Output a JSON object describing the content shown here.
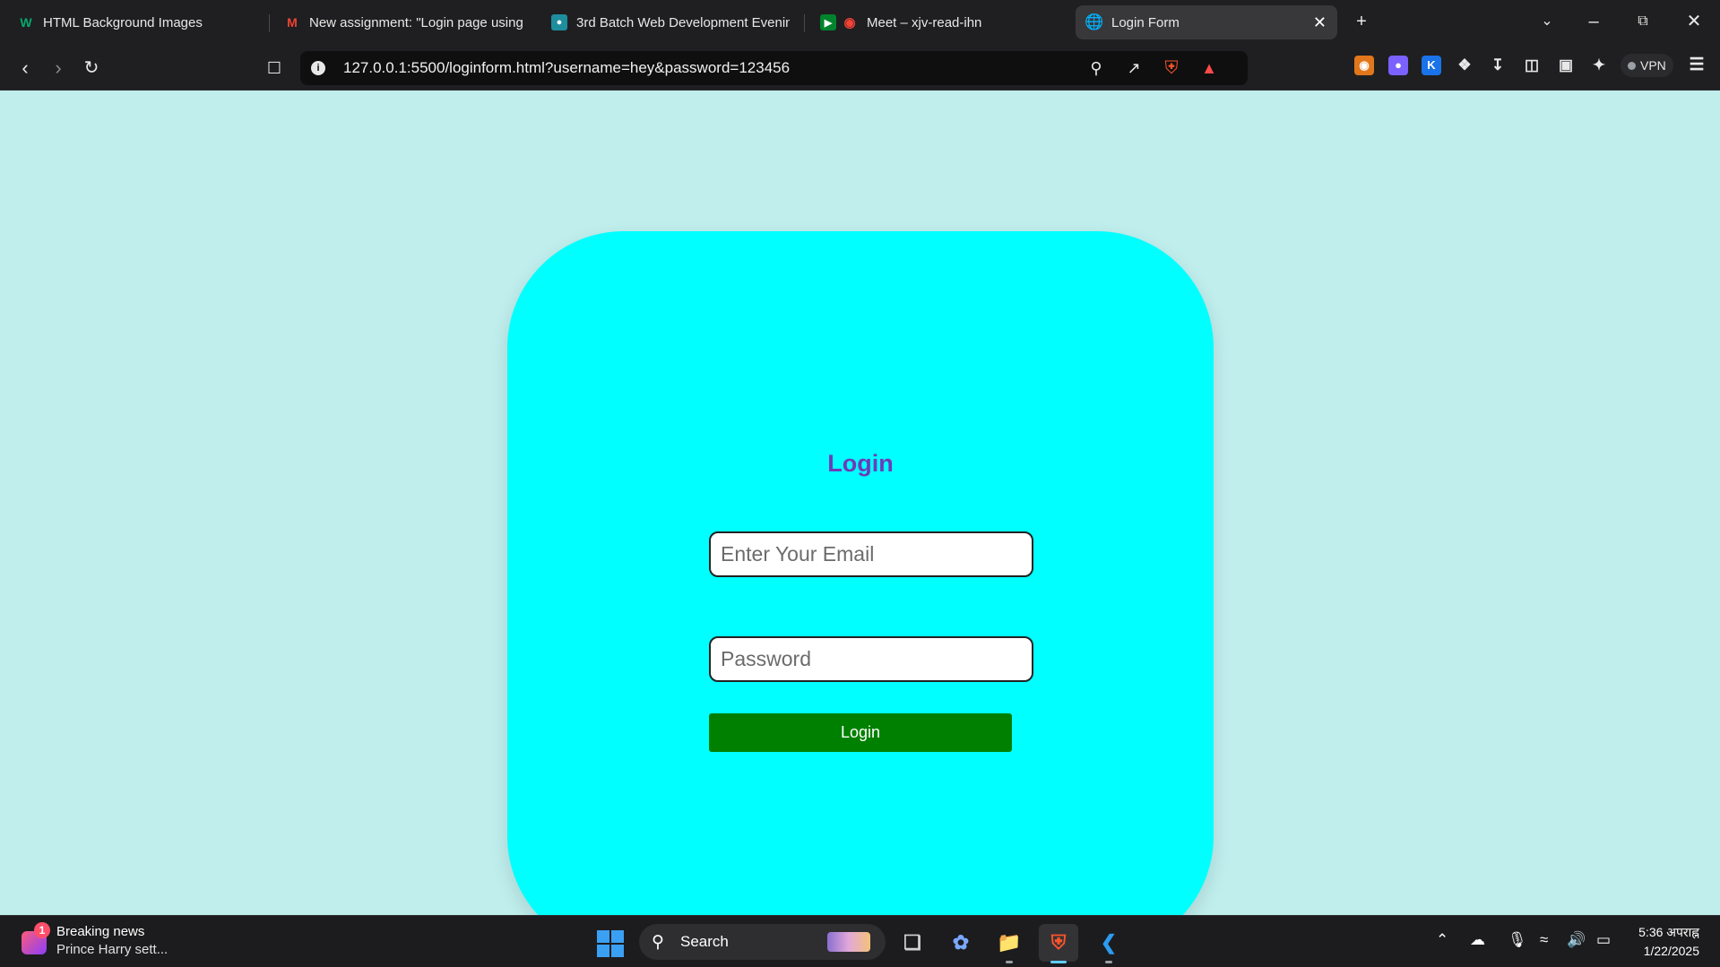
{
  "browser": {
    "tabs": [
      {
        "label": "HTML Background Images",
        "icon": "w3schools-icon",
        "active": false
      },
      {
        "label": "New assignment: \"Login page using",
        "icon": "gmail-icon",
        "active": false
      },
      {
        "label": "3rd Batch Web Development Evenin",
        "icon": "classroom-icon",
        "active": false
      },
      {
        "label": "Meet – xjv-read-ihn",
        "icon": "meet-icon",
        "active": false
      },
      {
        "label": "Login Form",
        "icon": "globe-icon",
        "active": true
      }
    ],
    "url": "127.0.0.1:5500/loginform.html?username=hey&password=123456",
    "vpn_label": "VPN"
  },
  "page": {
    "title": "Login",
    "email_placeholder": "Enter Your Email",
    "password_placeholder": "Password",
    "login_button": "Login",
    "colors": {
      "background": "#bfeeed",
      "card": "#00ffff",
      "title": "#6d3cb8",
      "button": "#008000"
    }
  },
  "taskbar": {
    "news_badge": "1",
    "news_title": "Breaking news",
    "news_subtitle": "Prince Harry sett...",
    "search_label": "Search",
    "clock_time": "5:36 अपराह्न",
    "clock_date": "1/22/2025"
  }
}
